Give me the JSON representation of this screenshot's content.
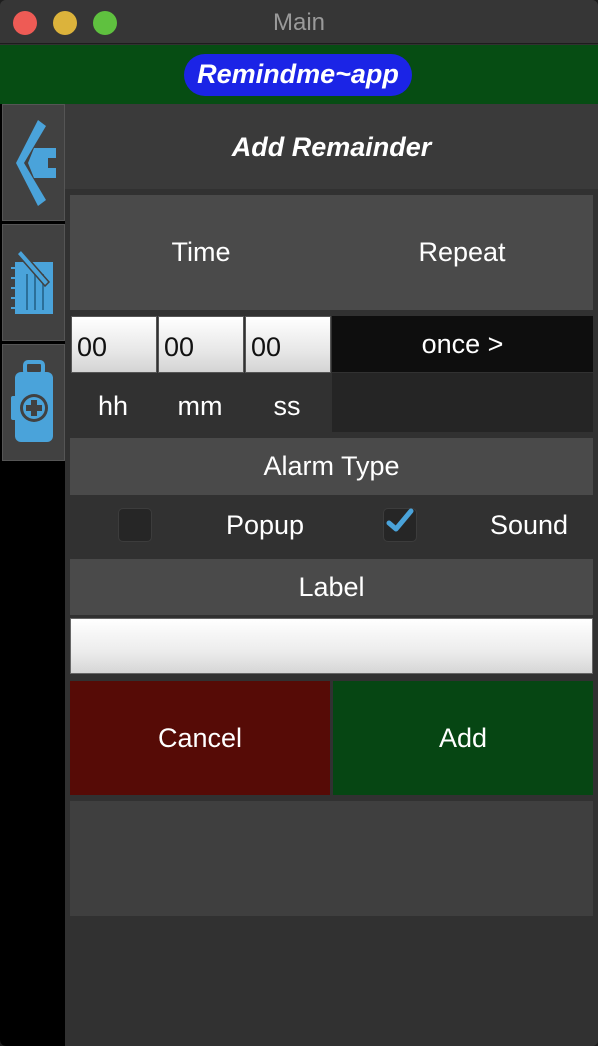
{
  "window": {
    "title": "Main"
  },
  "banner": {
    "text": "Remindme~app"
  },
  "sidebar": {
    "items": [
      {
        "icon": "back-arrow-icon"
      },
      {
        "icon": "notepad-icon"
      },
      {
        "icon": "medical-kit-icon"
      }
    ]
  },
  "form": {
    "title": "Add Remainder",
    "time_header": "Time",
    "repeat_header": "Repeat",
    "hh_value": "00",
    "mm_value": "00",
    "ss_value": "00",
    "hh_label": "hh",
    "mm_label": "mm",
    "ss_label": "ss",
    "repeat_value": "once >",
    "alarm_type_header": "Alarm Type",
    "popup_label": "Popup",
    "popup_checked": false,
    "sound_label": "Sound",
    "sound_checked": true,
    "label_header": "Label",
    "label_value": "",
    "cancel_label": "Cancel",
    "add_label": "Add"
  },
  "colors": {
    "banner_bg": "#064d13",
    "banner_pill": "#1b24e6",
    "cancel_bg": "#560b06",
    "add_bg": "#064613",
    "icon_blue": "#4aa3da"
  }
}
